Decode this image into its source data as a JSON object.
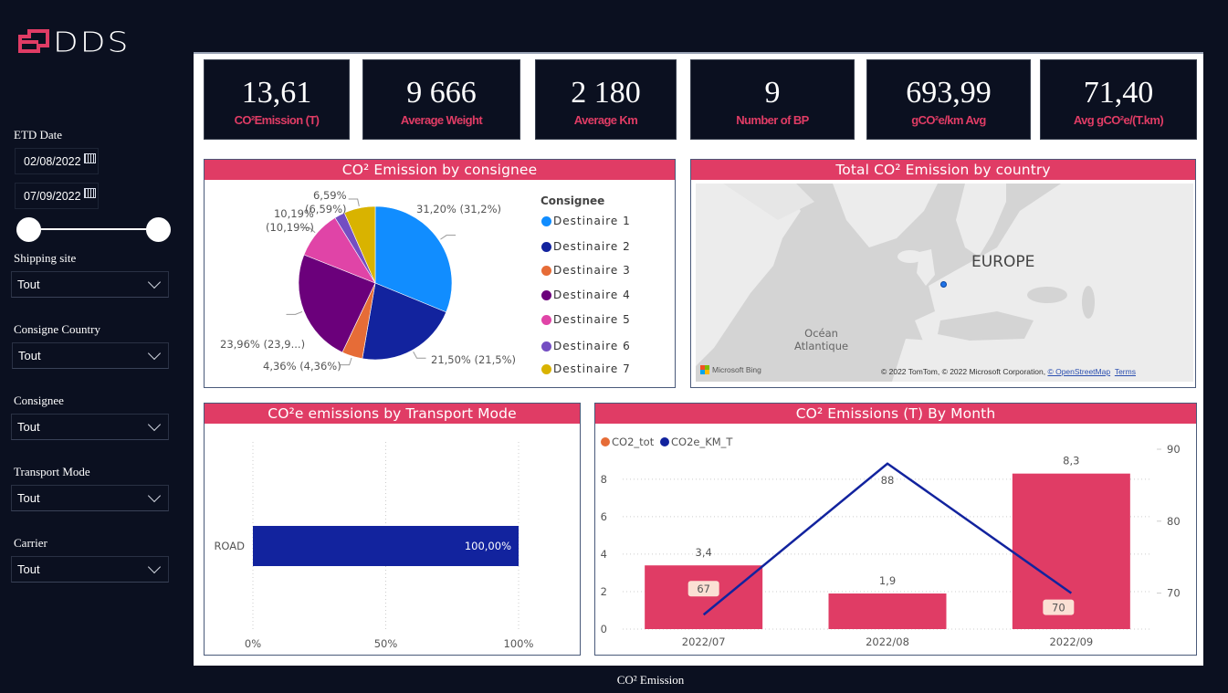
{
  "logo": {
    "text": "DDS",
    "accent": "#e03c65"
  },
  "filters": {
    "etd_date": {
      "label": "ETD Date",
      "start": "02/08/2022",
      "end": "07/09/2022",
      "range_fraction": [
        0,
        1
      ]
    },
    "dropdowns": [
      {
        "label": "Shipping site",
        "value": "Tout"
      },
      {
        "label": "Consigne Country",
        "value": "Tout"
      },
      {
        "label": "Consignee",
        "value": "Tout"
      },
      {
        "label": "Transport Mode",
        "value": "Tout"
      },
      {
        "label": "Carrier",
        "value": "Tout"
      }
    ]
  },
  "kpis": [
    {
      "value": "13,61",
      "label": "CO²Emission (T)"
    },
    {
      "value": "9 666",
      "label": "Average Weight"
    },
    {
      "value": "2 180",
      "label": "Average Km"
    },
    {
      "value": "9",
      "label": "Number of BP"
    },
    {
      "value": "693,99",
      "label": "gCO²e/km Avg"
    },
    {
      "value": "71,40",
      "label": "Avg gCO²e/(T.km)"
    }
  ],
  "map": {
    "title": "Total CO² Emission by country",
    "labels": {
      "region": "EUROPE",
      "ocean": "Océan\nAtlantique"
    },
    "bing": "Microsoft Bing",
    "attribution": "© 2022 TomTom, © 2022 Microsoft Corporation, ",
    "osm_link": "© OpenStreetMap",
    "terms_link": "Terms"
  },
  "footer": {
    "page_tab": "CO² Emission"
  },
  "chart_data": [
    {
      "type": "pie",
      "title": "CO² Emission by consignee",
      "legend_title": "Consignee",
      "legend_placement": "right",
      "categories": [
        "Destinaire 1",
        "Destinaire 2",
        "Destinaire 3",
        "Destinaire 4",
        "Destinaire 5",
        "Destinaire 6",
        "Destinaire 7"
      ],
      "values": [
        31.2,
        21.5,
        4.36,
        23.96,
        10.19,
        2.2,
        6.59
      ],
      "colors": [
        "#118dff",
        "#12239e",
        "#e66c37",
        "#6b007b",
        "#e044a7",
        "#744ec2",
        "#d9b300"
      ],
      "data_labels": [
        "31,20% (31,2%)",
        "21,50% (21,5%)",
        "4,36% (4,36%)",
        "23,96% (23,9...)",
        "10,19%\n(10,19%)",
        "",
        "6,59%\n(6,59%)"
      ]
    },
    {
      "type": "bar",
      "orientation": "horizontal",
      "title": "CO²e emissions by Transport Mode",
      "categories": [
        "ROAD"
      ],
      "values": [
        100
      ],
      "data_labels": [
        "100,00%"
      ],
      "xlim": [
        0,
        100
      ],
      "xticks": [
        "0%",
        "50%",
        "100%"
      ],
      "color": "#12239e",
      "grid": true
    },
    {
      "type": "bar",
      "combo": "bar+line",
      "title": "CO² Emissions (T) By Month",
      "legend_placement": "top-left",
      "categories": [
        "2022/07",
        "2022/08",
        "2022/09"
      ],
      "series": [
        {
          "name": "CO2_tot",
          "kind": "bar",
          "axis": "left",
          "values": [
            3.4,
            1.9,
            8.3
          ],
          "data_labels": [
            "3,4",
            "1,9",
            "8,3"
          ],
          "legend_color": "#e66c37",
          "color": "#e03c65"
        },
        {
          "name": "CO2e_KM_T",
          "kind": "line",
          "axis": "right",
          "values": [
            67,
            88,
            70
          ],
          "data_labels": [
            "67",
            "88",
            "70"
          ],
          "color": "#12239e"
        }
      ],
      "ylim_left": [
        0,
        9.6
      ],
      "yticks_left": [
        "0",
        "2",
        "4",
        "6",
        "8"
      ],
      "ylim_right": [
        65,
        90
      ],
      "yticks_right": [
        "70",
        "80",
        "90"
      ],
      "grid": true
    }
  ]
}
